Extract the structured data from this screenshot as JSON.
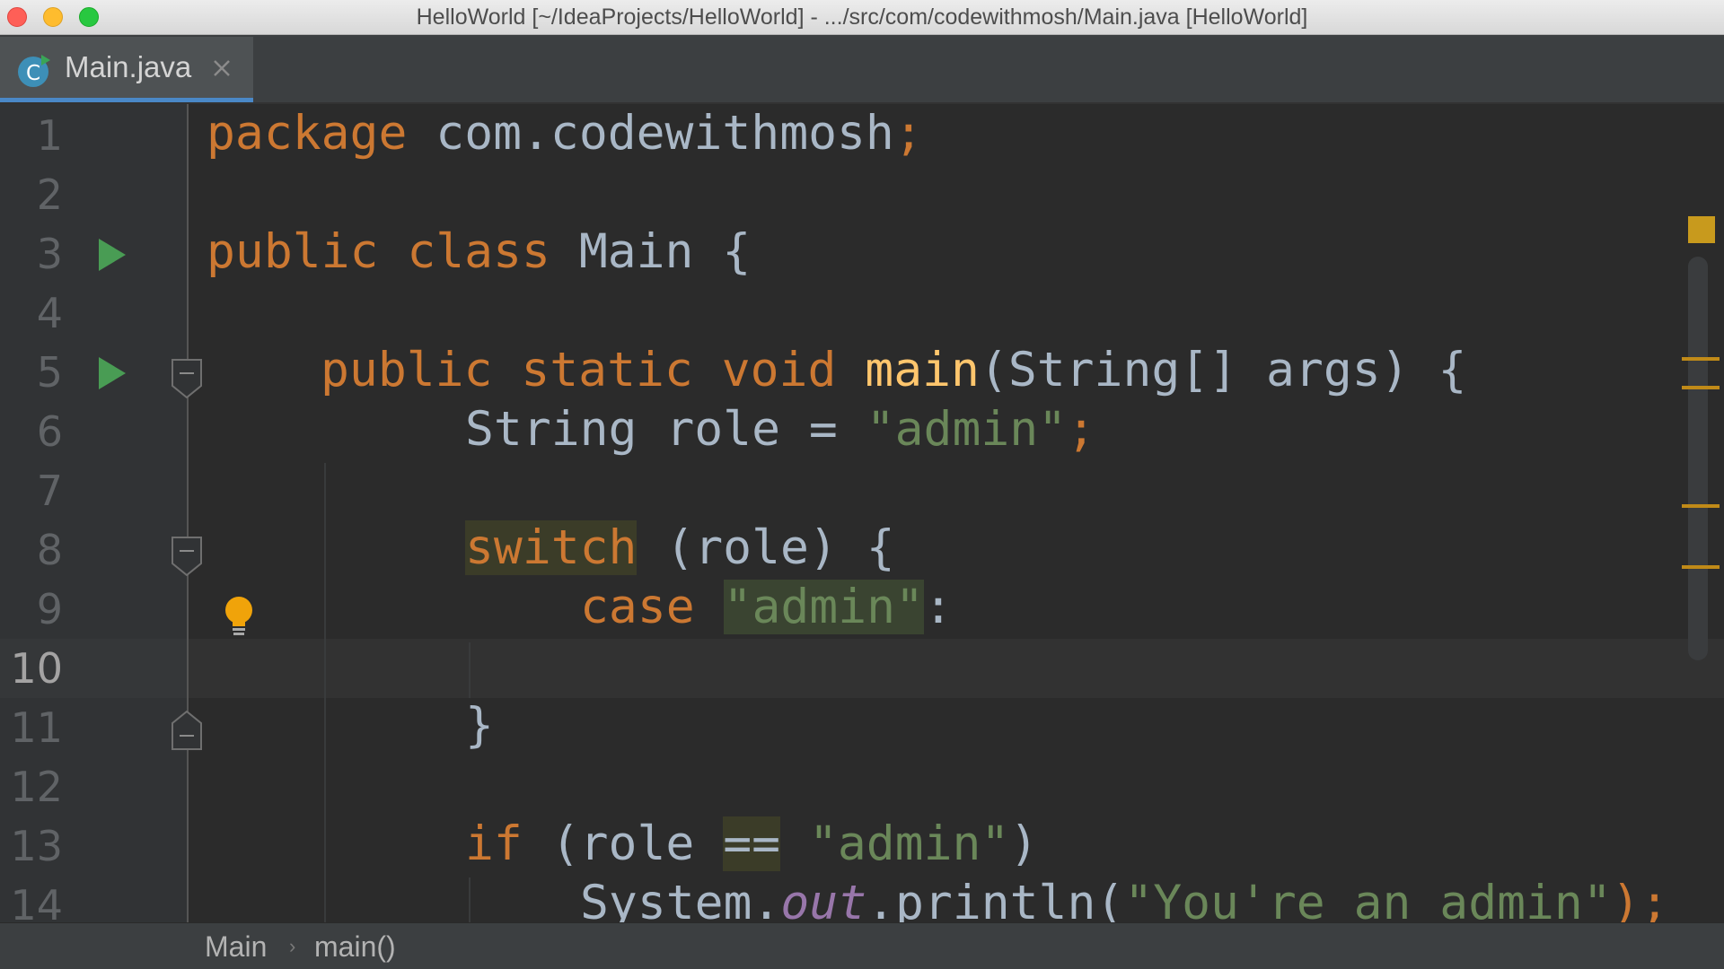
{
  "window": {
    "title": "HelloWorld [~/IdeaProjects/HelloWorld] - .../src/com/codewithmosh/Main.java [HelloWorld]"
  },
  "tabs": [
    {
      "label": "Main.java",
      "icon": "java-class-icon",
      "active": true
    }
  ],
  "editor": {
    "current_line": 10,
    "line_numbers": [
      "1",
      "2",
      "3",
      "4",
      "5",
      "6",
      "7",
      "8",
      "9",
      "10",
      "11",
      "12",
      "13",
      "14"
    ],
    "lines": {
      "l1": {
        "t1": "package",
        "t2": " com.codewithmosh",
        "t3": ";"
      },
      "l3": {
        "t1": "public class",
        "t2": " Main {"
      },
      "l5": {
        "t1": "public static void",
        "t2": " ",
        "t3": "main",
        "t4": "(String[] args) {"
      },
      "l6": {
        "t1": "String role = ",
        "t2": "\"admin\"",
        "t3": ";"
      },
      "l8": {
        "t1": "switch",
        "t2": " (role) {"
      },
      "l9": {
        "t1": "case",
        "t2": " ",
        "t3": "\"admin\"",
        "t4": ":"
      },
      "l11": {
        "t1": "}"
      },
      "l13": {
        "t1": "if",
        "t2": " (role ",
        "t3": "==",
        "t4": " ",
        "t5": "\"admin\"",
        "t6": ")"
      },
      "l14": {
        "t1": "System.",
        "t2": "out",
        "t3": ".println(",
        "t4": "\"You're an admin\"",
        "t5": ");"
      }
    }
  },
  "breadcrumb": {
    "items": [
      "Main",
      "main()"
    ],
    "separator": "›"
  },
  "colors": {
    "keyword": "#cc7832",
    "string": "#6a8759",
    "function": "#ffc66d",
    "field": "#9876aa",
    "text": "#a9b7c6",
    "run": "#499c54",
    "tab_underline": "#4a88c7"
  }
}
